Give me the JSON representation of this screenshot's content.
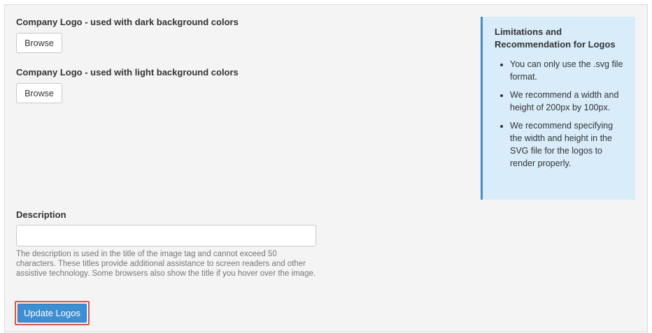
{
  "dark_logo": {
    "label": "Company Logo - used with dark background colors",
    "browse_label": "Browse"
  },
  "light_logo": {
    "label": "Company Logo - used with light background colors",
    "browse_label": "Browse"
  },
  "info": {
    "title": "Limitations and Recommendation for Logos",
    "items": [
      "You can only use the .svg file format.",
      "We recommend a width and height of 200px by 100px.",
      "We recommend specifying the width and height in the SVG file for the logos to render properly."
    ]
  },
  "description": {
    "label": "Description",
    "value": "",
    "help": "The description is used in the title of the image tag and cannot exceed 50 characters. These titles provide additional assistance to screen readers and other assistive technology. Some browsers also show the title if you hover over the image."
  },
  "actions": {
    "update_label": "Update Logos"
  },
  "colors": {
    "accent": "#3d8fd1",
    "highlight": "#d9534f",
    "info_bg": "#d9ecf9"
  }
}
